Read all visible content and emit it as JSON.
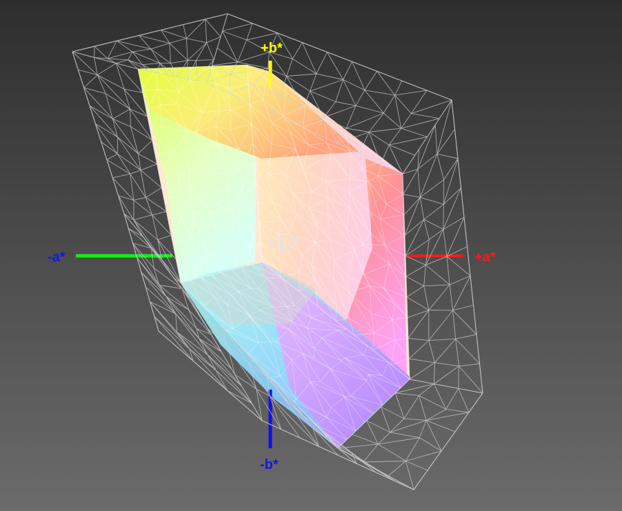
{
  "axes": {
    "plus_b": "+b*",
    "minus_b": "-b*",
    "plus_a": "+a*",
    "minus_a": "-a*",
    "plus_l": "+L*"
  },
  "colors": {
    "background_top": "#2f2f2f",
    "background_bottom": "#6a6a6a",
    "wireframe": "#d0d0d0",
    "axis_plus_b": "#ffff00",
    "axis_minus_b": "#1010ee",
    "axis_plus_a": "#ff1a1a",
    "axis_minus_a": "#12ee12",
    "label_minus_a": "#1515ee"
  }
}
